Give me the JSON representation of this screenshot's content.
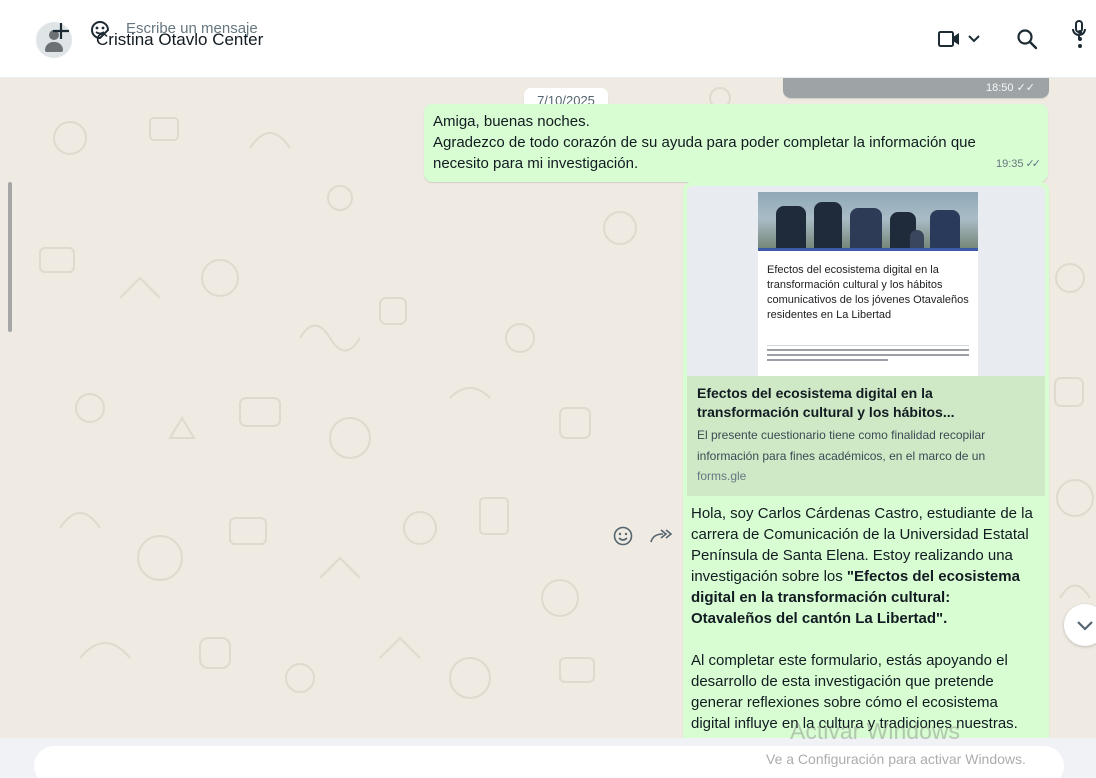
{
  "header": {
    "contact_name": "Cristina Otavlo Center",
    "icons": [
      "avatar-person-icon",
      "video-call-icon",
      "chevron-down-icon",
      "search-icon",
      "menu-icon"
    ]
  },
  "chat": {
    "previous_message_time": "18:50",
    "date_chip": "7/10/2025",
    "message1": {
      "lines": [
        "Amiga, buenas noches.",
        "Agradezco de todo corazón de su ayuda para poder completar la información que",
        "necesito para mi investigación."
      ],
      "time": "19:35"
    },
    "message2": {
      "form_image_title": "Efectos del ecosistema digital en la transformación cultural y los hábitos comunicativos de los jóvenes Otavaleños residentes en La Libertad",
      "link_title_line1": "Efectos del ecosistema digital en la",
      "link_title_line2": "transformación cultural y los hábitos...",
      "link_desc_line1": "El presente cuestionario tiene como finalidad recopilar",
      "link_desc_line2": "información para fines académicos, en el marco de un",
      "link_domain": "forms.gle",
      "para1_line1": "Hola, soy Carlos Cárdenas Castro, estudiante de la",
      "para1_line2": "carrera de Comunicación de la Universidad Estatal",
      "para1_line3": "Península de Santa Elena. Estoy realizando una",
      "para1_line4_plain": "investigación sobre los ",
      "para1_line4_bold": "\"Efectos del ecosistema",
      "para1_line5_bold": "digital en la transformación cultural:",
      "para1_line6_bold": "Otavaleños del cantón La Libertad\"",
      "para1_line6_end": ".",
      "para2_line1": "Al completar este formulario, estás apoyando el",
      "para2_line2": "desarrollo de esta investigación que pretende",
      "para2_line3": "generar reflexiones sobre cómo el ecosistema",
      "para2_line4": "digital influye en la cultura y tradiciones nuestras."
    }
  },
  "compose": {
    "placeholder": "Escribe un mensaje"
  },
  "watermark": {
    "line1": "Activar Windows",
    "line2": "Ve a Configuración para activar Windows."
  },
  "colors": {
    "outgoing_bubble": "#d9fdd3",
    "chat_background": "#efeae2",
    "header_background": "#ffffff"
  }
}
